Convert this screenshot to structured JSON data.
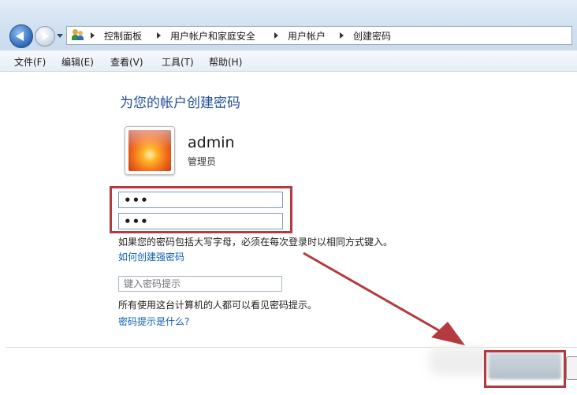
{
  "address_bar": {
    "breadcrumbs": [
      "控制面板",
      "用户帐户和家庭安全",
      "用户帐户",
      "创建密码"
    ]
  },
  "menu": {
    "items": [
      "文件(F)",
      "编辑(E)",
      "查看(V)",
      "工具(T)",
      "帮助(H)"
    ]
  },
  "main": {
    "title": "为您的帐户创建密码",
    "user": {
      "name": "admin",
      "role": "管理员"
    },
    "new_password_value": "•••",
    "confirm_password_value": "•••",
    "caps_note": "如果您的密码包括大写字母，必须在每次登录时以相同方式键入。",
    "strong_password_link": "如何创建强密码",
    "hint_placeholder": "键入密码提示",
    "hint_note": "所有使用这台计算机的人都可以看见密码提示。",
    "hint_link": "密码提示是什么?"
  },
  "icons": {
    "back": "back-arrow-icon",
    "forward": "forward-arrow-icon",
    "users": "users-icon",
    "chevron": "chevron-right-icon"
  },
  "colors": {
    "annotation_red": "#b33a3f",
    "link": "#0d5fb0",
    "heading": "#1f4e96"
  }
}
